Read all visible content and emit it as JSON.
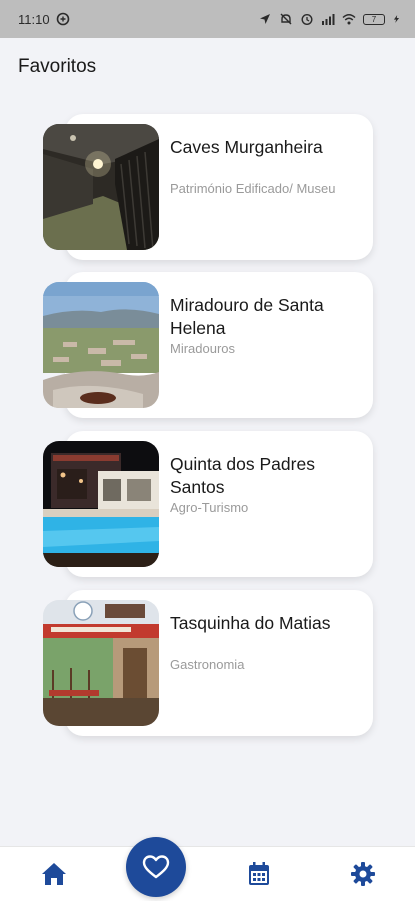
{
  "status_bar": {
    "time": "11:10",
    "battery": "7"
  },
  "page": {
    "title": "Favoritos"
  },
  "favorites": [
    {
      "title": "Caves Murganheira",
      "category": "Património Edificado/ Museu",
      "image": "cave-cellar-photo"
    },
    {
      "title": "Miradouro de Santa Helena",
      "category": "Miradouros",
      "image": "mountain-viewpoint-photo"
    },
    {
      "title": "Quinta dos Padres Santos",
      "category": "Agro-Turismo",
      "image": "night-pool-photo"
    },
    {
      "title": "Tasquinha do Matias",
      "category": "Gastronomia",
      "image": "restaurant-terrace-photo"
    }
  ],
  "nav": {
    "items": [
      "home-icon",
      "heart-icon",
      "calendar-icon",
      "gear-icon"
    ],
    "active": "heart-icon",
    "accent_color": "#1e4a9a"
  }
}
